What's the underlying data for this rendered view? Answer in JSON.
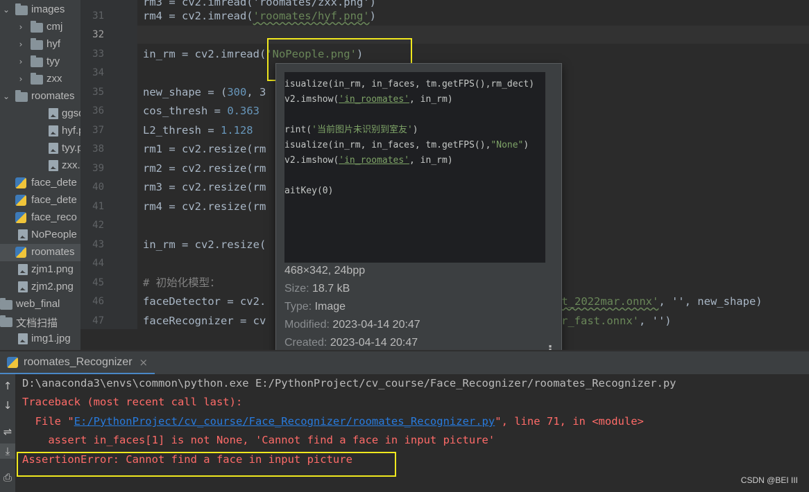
{
  "tree": [
    {
      "label": "images",
      "kind": "folder",
      "chev": "down",
      "indent": 0
    },
    {
      "label": "cmj",
      "kind": "folder",
      "chev": "right",
      "indent": 1
    },
    {
      "label": "hyf",
      "kind": "folder",
      "chev": "right",
      "indent": 1
    },
    {
      "label": "tyy",
      "kind": "folder",
      "chev": "right",
      "indent": 1
    },
    {
      "label": "zxx",
      "kind": "folder",
      "chev": "right",
      "indent": 1
    },
    {
      "label": "roomates",
      "kind": "folder",
      "chev": "down",
      "indent": 0
    },
    {
      "label": "ggsq.p",
      "kind": "image",
      "chev": "",
      "indent": 2
    },
    {
      "label": "hyf.pn",
      "kind": "image",
      "chev": "",
      "indent": 2
    },
    {
      "label": "tyy.pn",
      "kind": "image",
      "chev": "",
      "indent": 2
    },
    {
      "label": "zxx.pn",
      "kind": "image",
      "chev": "",
      "indent": 2
    },
    {
      "label": "face_dete",
      "kind": "python",
      "chev": "",
      "indent": 0
    },
    {
      "label": "face_dete",
      "kind": "python",
      "chev": "",
      "indent": 0
    },
    {
      "label": "face_reco",
      "kind": "python",
      "chev": "",
      "indent": 0
    },
    {
      "label": "NoPeople",
      "kind": "image",
      "chev": "",
      "indent": 0
    },
    {
      "label": "roomates",
      "kind": "python",
      "chev": "",
      "indent": 0
    },
    {
      "label": "zjm1.png",
      "kind": "image",
      "chev": "",
      "indent": 0
    },
    {
      "label": "zjm2.png",
      "kind": "image",
      "chev": "",
      "indent": 0
    },
    {
      "label": "web_final",
      "kind": "folder",
      "chev": "",
      "indent": -1
    },
    {
      "label": "文档扫描",
      "kind": "folder",
      "chev": "",
      "indent": -1
    },
    {
      "label": "img1.jpg",
      "kind": "image",
      "chev": "",
      "indent": 0
    }
  ],
  "line_numbers": [
    "31",
    "32",
    "33",
    "34",
    "35",
    "36",
    "37",
    "38",
    "39",
    "40",
    "41",
    "42",
    "43",
    "44",
    "45",
    "46",
    "47"
  ],
  "code": {
    "l30": "rm3 = cv2.imread('roomates/zxx.png')",
    "l31_a": "rm4 = cv2.imread(",
    "l31_s": "'roomates/hyf.png'",
    "l31_b": ")",
    "l33_a": "in_rm = cv2.imread(",
    "l33_s": "'NoPeople.png'",
    "l33_b": ")",
    "l35_a": "new_shape = (",
    "l35_n": "300",
    "l35_b": ", 3",
    "l36_a": "cos_thresh = ",
    "l36_n": "0.363",
    "l37_a": "L2_thresh = ",
    "l37_n": "1.128",
    "l38": "rm1 = cv2.resize(rm",
    "l39": "rm2 = cv2.resize(rm",
    "l40": "rm3 = cv2.resize(rm",
    "l41": "rm4 = cv2.resize(rm",
    "l43": "in_rm = cv2.resize(",
    "l45": "# 初始化模型：",
    "l46_a": "faceDetector = cv2.",
    "l46_s": "et_2022mar.onnx'",
    "l46_b": ", '', new_shape)",
    "l47_a": "faceRecognizer = cv",
    "l47_s": "r_fast.onnx'",
    "l47_b": ", '')"
  },
  "popup": {
    "thumb_lines": [
      {
        "a": "isualize(in_rm, in_faces, tm.getFPS(),rm_dect)",
        "s": ""
      },
      {
        "a": "v2.imshow(",
        "s": "'in_roomates'",
        "b": ", in_rm)"
      },
      {
        "a": "",
        "s": ""
      },
      {
        "a": "rint(",
        "s": "'当前图片未识别到室友'",
        "b": ")"
      },
      {
        "a": "isualize(in_rm, in_faces, tm.getFPS(),",
        "s": "\"None\"",
        "b": ")"
      },
      {
        "a": "v2.imshow(",
        "s": "'in_roomates'",
        "b": ", in_rm)"
      },
      {
        "a": "",
        "s": ""
      },
      {
        "a": "aitKey(0)",
        "s": ""
      }
    ],
    "dimensions": "468×342, 24bpp",
    "size_key": "Size:",
    "size_val": "18.7 kB",
    "type_key": "Type:",
    "type_val": "Image",
    "modified_key": "Modified:",
    "modified_val": "2023-04-14 20:47",
    "created_key": "Created:",
    "created_val": "2023-04-14 20:47"
  },
  "run": {
    "tab_label": "roomates_Recognizer",
    "tab_close": "×",
    "tools": [
      "↑",
      "↓",
      "⇌",
      "⤓",
      "⎙"
    ]
  },
  "console": {
    "cmd": "D:\\anaconda3\\envs\\common\\python.exe E:/PythonProject/cv_course/Face_Recognizer/roomates_Recognizer.py",
    "traceback": "Traceback (most recent call last):",
    "file_pre": "  File \"",
    "file_link": "E:/PythonProject/cv_course/Face_Recognizer/roomates_Recognizer.py",
    "file_post": "\", line 71, in <module>",
    "assert_line": "    assert in_faces[1] is not None, 'Cannot find a face in input picture'",
    "error": "AssertionError: Cannot find a face in input picture"
  },
  "watermark": "CSDN @BEI III",
  "colors": {
    "highlight_box": "#f0e81e",
    "error_red": "#ff6b68",
    "link_blue": "#287bde",
    "string_green": "#6a8759",
    "number_blue": "#6897bb"
  }
}
